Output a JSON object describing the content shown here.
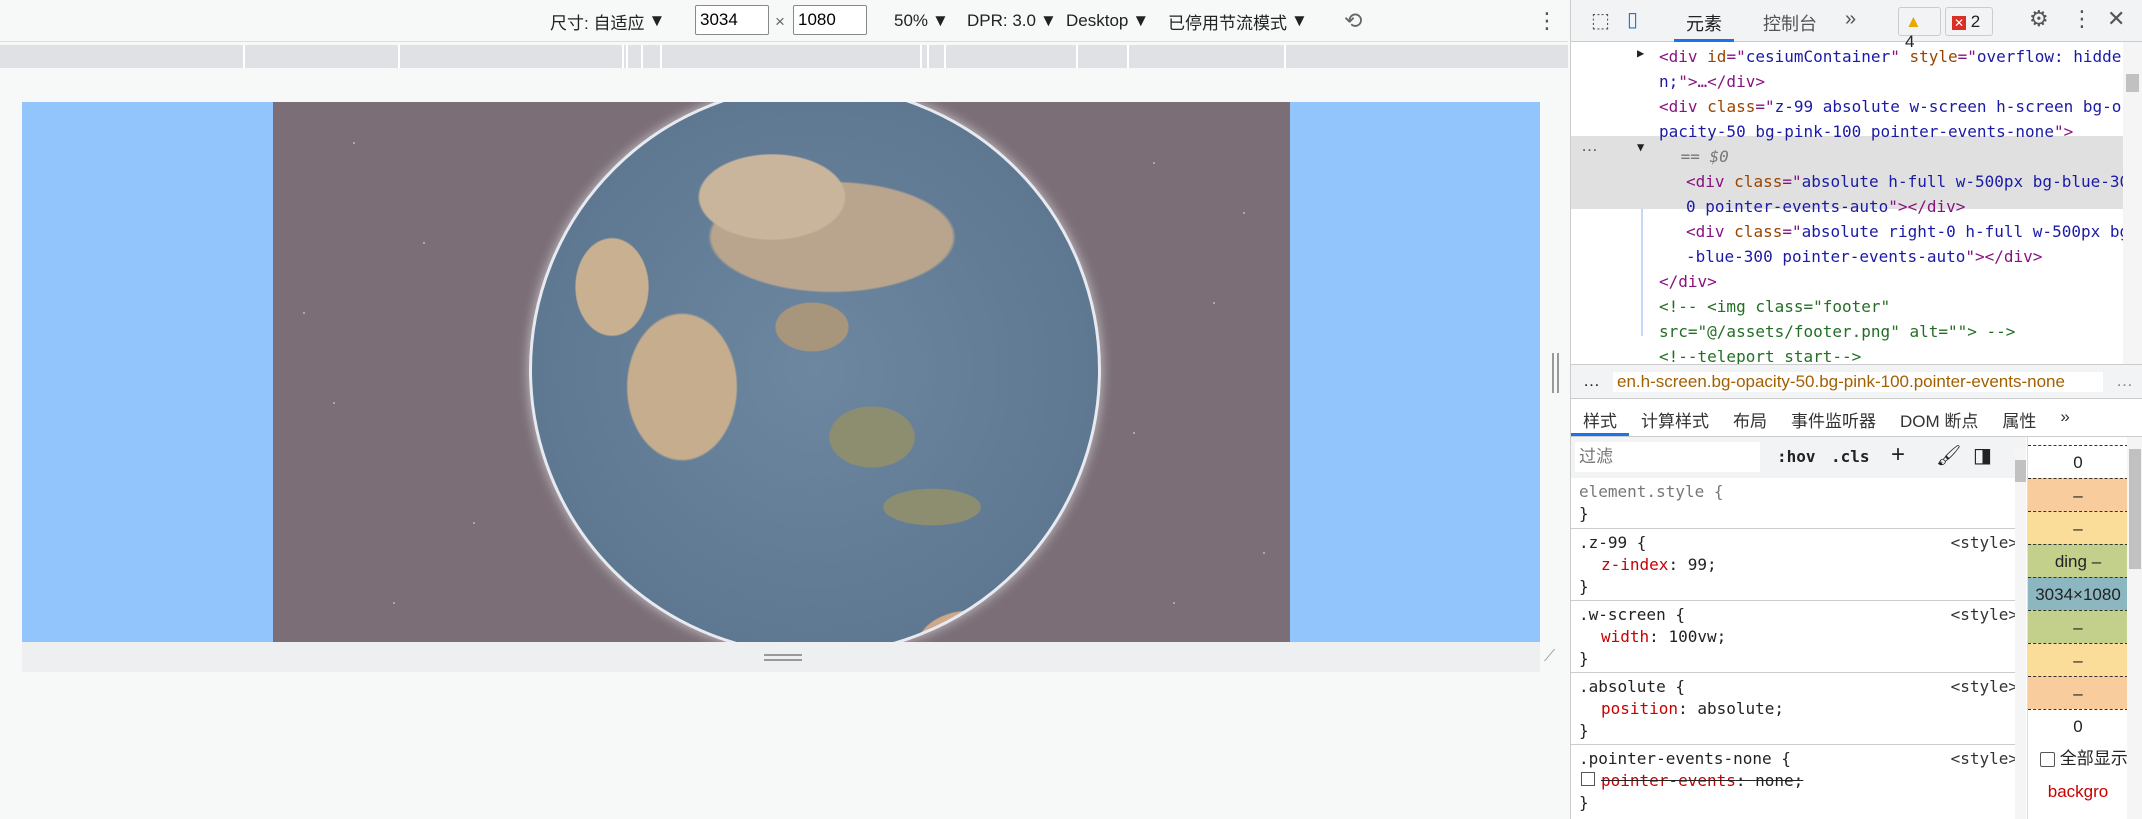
{
  "toolbar": {
    "size_label": "尺寸: 自适应",
    "width": "3034",
    "height": "1080",
    "times": "×",
    "zoom": "50%",
    "dpr": "DPR: 3.0",
    "device": "Desktop",
    "throttle": "已停用节流模式"
  },
  "devtools": {
    "tabs": [
      "元素",
      "控制台"
    ],
    "more": "»",
    "warnings": "4",
    "errors": "2",
    "dom": [
      {
        "parts": [
          [
            "tag",
            "<div "
          ],
          [
            "attr",
            "id"
          ],
          [
            "tag",
            "=\""
          ],
          [
            "val",
            "cesiumContainer"
          ],
          [
            "tag",
            "\" "
          ],
          [
            "attr",
            "style"
          ],
          [
            "tag",
            "=\""
          ],
          [
            "val",
            "overflow: hidde"
          ]
        ]
      },
      {
        "parts": [
          [
            "val",
            "n;"
          ],
          [
            "tag",
            "\">…</div>"
          ]
        ]
      },
      {
        "parts": [
          [
            "tag",
            "<div "
          ],
          [
            "attr",
            "class"
          ],
          [
            "tag",
            "=\""
          ],
          [
            "val",
            "z-99 absolute w-screen h-screen bg-o"
          ]
        ]
      },
      {
        "parts": [
          [
            "val",
            "pacity-50 bg-pink-100 pointer-events-none"
          ],
          [
            "tag",
            "\">"
          ]
        ]
      },
      {
        "parts": [
          [
            "cm",
            " == $0"
          ]
        ]
      },
      {
        "parts": [
          [
            "tag",
            "<div "
          ],
          [
            "attr",
            "class"
          ],
          [
            "tag",
            "=\""
          ],
          [
            "val",
            "absolute h-full w-500px bg-blue-30"
          ]
        ]
      },
      {
        "parts": [
          [
            "val",
            "0 pointer-events-auto"
          ],
          [
            "tag",
            "\"></div>"
          ]
        ]
      },
      {
        "parts": [
          [
            "tag",
            "<div "
          ],
          [
            "attr",
            "class"
          ],
          [
            "tag",
            "=\""
          ],
          [
            "val",
            "absolute right-0 h-full w-500px bg"
          ]
        ]
      },
      {
        "parts": [
          [
            "val",
            "-blue-300 pointer-events-auto"
          ],
          [
            "tag",
            "\"></div>"
          ]
        ]
      },
      {
        "parts": [
          [
            "tag",
            "</div>"
          ]
        ]
      },
      {
        "parts": [
          [
            "cm",
            "<!-- <img class=\"footer\""
          ]
        ]
      },
      {
        "parts": [
          [
            "cm",
            "src=\"@/assets/footer.png\" alt=\"\"> -->"
          ]
        ]
      },
      {
        "parts": [
          [
            "cm",
            "<!--teleport start-->"
          ]
        ]
      }
    ],
    "breadcrumb": "en.h-screen.bg-opacity-50.bg-pink-100.pointer-events-none",
    "style_tabs": [
      "样式",
      "计算样式",
      "布局",
      "事件监听器",
      "DOM 断点",
      "属性"
    ],
    "filter_placeholder": "过滤",
    "hov": ":hov",
    "cls": ".cls",
    "rules": [
      {
        "sel": "element.style {",
        "prop": "",
        "val": "",
        "src": ""
      },
      {
        "sel": ".z-99 {",
        "prop": "z-index",
        "val": "99;",
        "src": "<style>"
      },
      {
        "sel": ".w-screen {",
        "prop": "width",
        "val": "100vw;",
        "src": "<style>"
      },
      {
        "sel": ".absolute {",
        "prop": "position",
        "val": "absolute;",
        "src": "<style>"
      },
      {
        "sel": ".pointer-events-none {",
        "prop": "pointer-events",
        "val": "none;",
        "src": "<style>"
      }
    ],
    "boxmodel": [
      "0",
      "–",
      "–",
      "ding  –",
      "3034×1080",
      "–",
      "–",
      "–",
      "0"
    ],
    "show_all": "全部显示",
    "bottom_prop": "backgro"
  }
}
